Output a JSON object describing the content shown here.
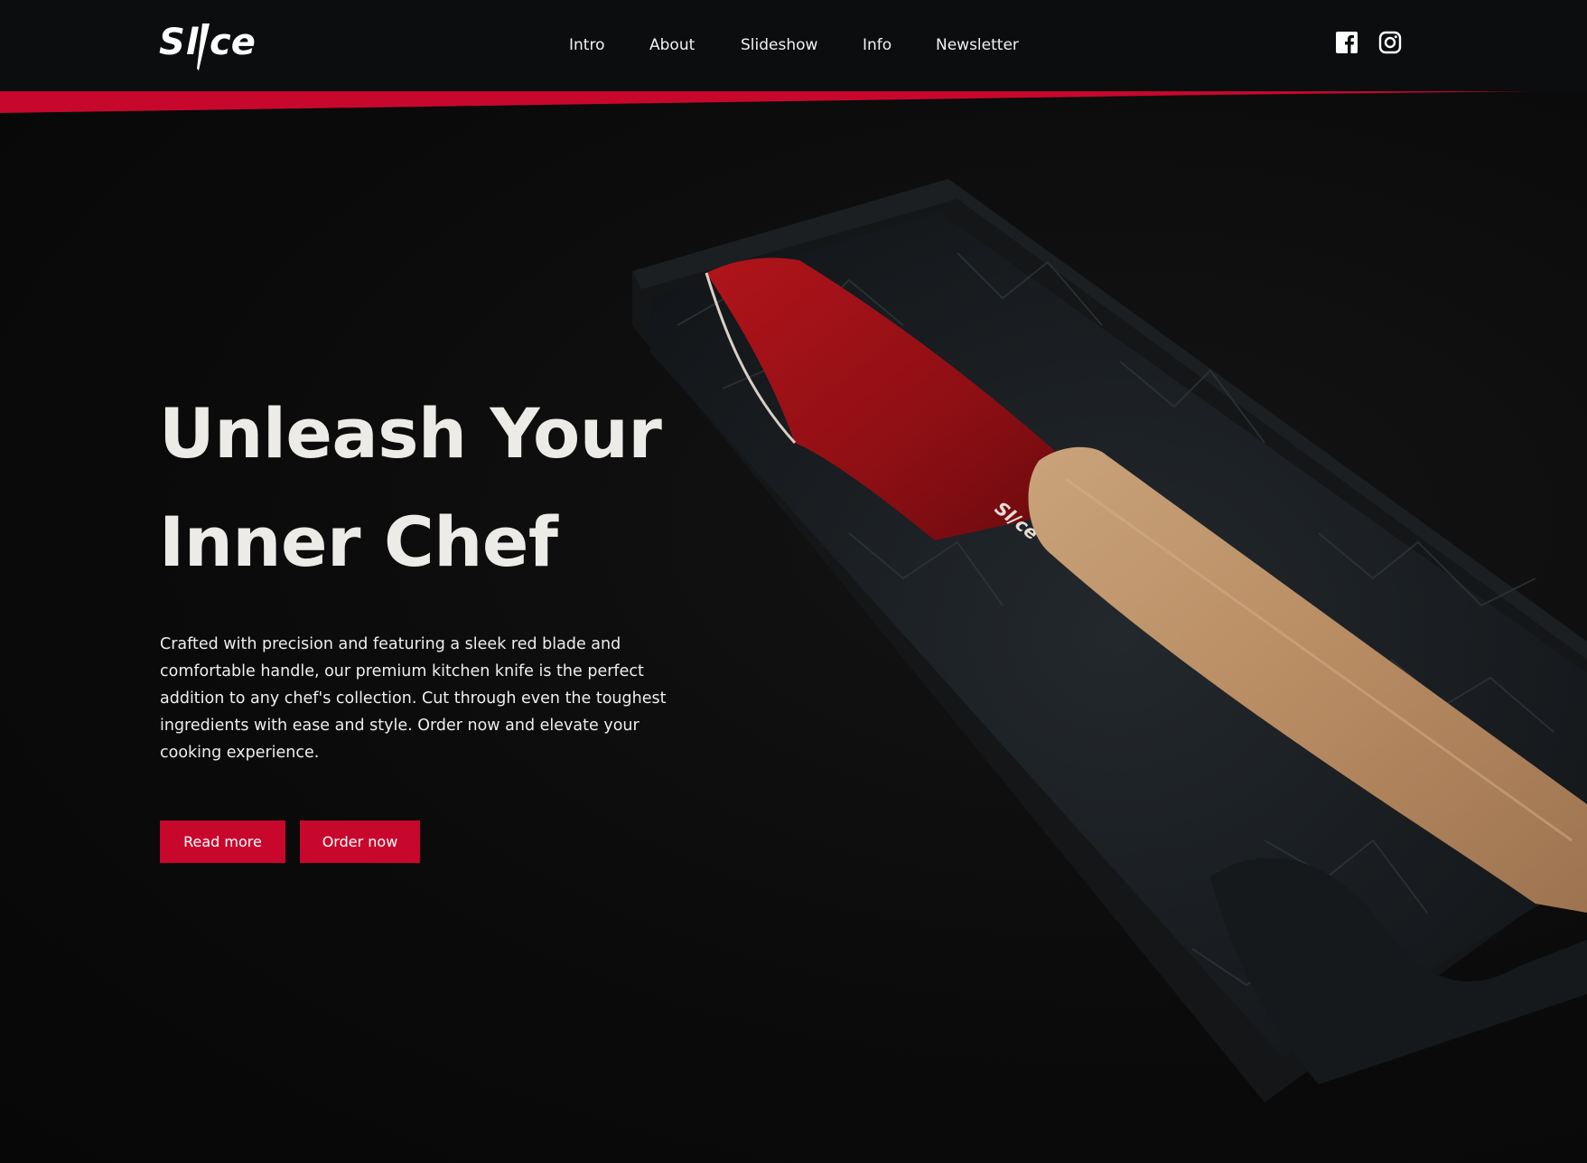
{
  "brand": {
    "logo_text": "Sl/ce",
    "accent_color": "#c8072d"
  },
  "nav": {
    "items": [
      {
        "label": "Intro"
      },
      {
        "label": "About"
      },
      {
        "label": "Slideshow"
      },
      {
        "label": "Info"
      },
      {
        "label": "Newsletter"
      }
    ]
  },
  "social": {
    "icons": [
      "facebook-icon",
      "instagram-icon"
    ]
  },
  "hero": {
    "headline_line1": "Unleash Your",
    "headline_line2": "Inner Chef",
    "description": "Crafted with precision and featuring a sleek red blade and comfortable handle, our premium kitchen knife is the perfect addition to any chef's collection. Cut through even the toughest ingredients with ease and style. Order now and elevate your cooking experience.",
    "buttons": {
      "read_more": "Read more",
      "order_now": "Order now"
    },
    "blade_logo": "Sl/ce"
  }
}
